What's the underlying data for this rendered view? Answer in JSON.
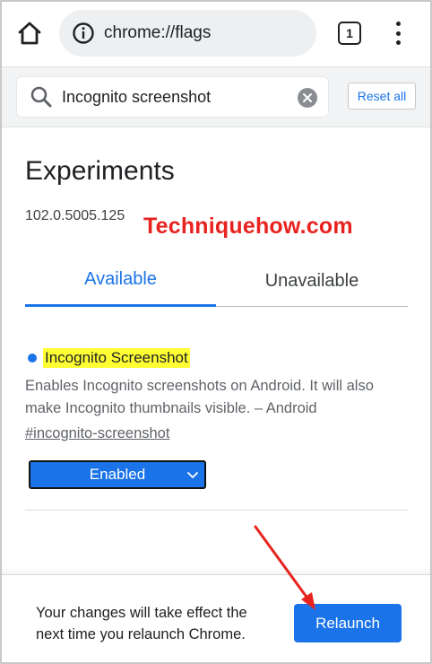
{
  "browser": {
    "url": "chrome://flags",
    "tab_count": "1"
  },
  "search": {
    "value": "Incognito screenshot",
    "reset_label": "Reset all"
  },
  "page": {
    "title": "Experiments",
    "version": "102.0.5005.125",
    "watermark": "Techniquehow.com"
  },
  "tabs": [
    {
      "label": "Available",
      "selected": true
    },
    {
      "label": "Unavailable",
      "selected": false
    }
  ],
  "flag": {
    "name": "Incognito Screenshot",
    "description": "Enables Incognito screenshots on Android. It will also make Incognito thumbnails visible. – Android",
    "link": "#incognito-screenshot",
    "state": "Enabled"
  },
  "footer": {
    "message": "Your changes will take effect the next time you relaunch Chrome.",
    "relaunch_label": "Relaunch"
  },
  "colors": {
    "accent": "#1a73e8",
    "highlight": "#ffff33",
    "annotation": "#e8231f"
  }
}
